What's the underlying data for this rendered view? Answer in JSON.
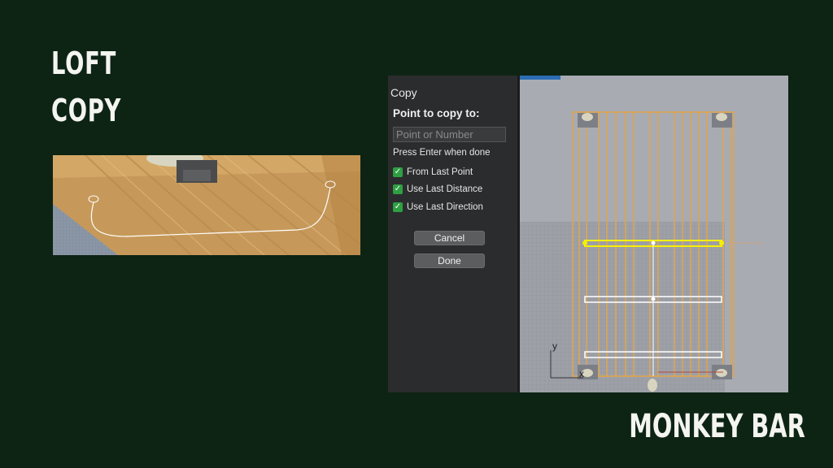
{
  "slide": {
    "heading_line1": "LOFT",
    "heading_line2": "COPY",
    "footer": "MONKEY BAR"
  },
  "command_panel": {
    "title": "Copy",
    "prompt": "Point to copy to:",
    "input_placeholder": "Point or Number",
    "hint": "Press Enter when done",
    "options": [
      {
        "label": "From Last Point",
        "checked": true
      },
      {
        "label": "Use Last Distance",
        "checked": true
      },
      {
        "label": "Use Last Direction",
        "checked": true
      }
    ],
    "cancel_label": "Cancel",
    "done_label": "Done"
  },
  "viewport": {
    "axis_y": "y",
    "axis_x": "x"
  },
  "colors": {
    "background": "#0d2414",
    "panel": "#2b2c2d",
    "wood": "#e0a54a",
    "selected": "#f5f000",
    "checkbox": "#2ea043"
  }
}
